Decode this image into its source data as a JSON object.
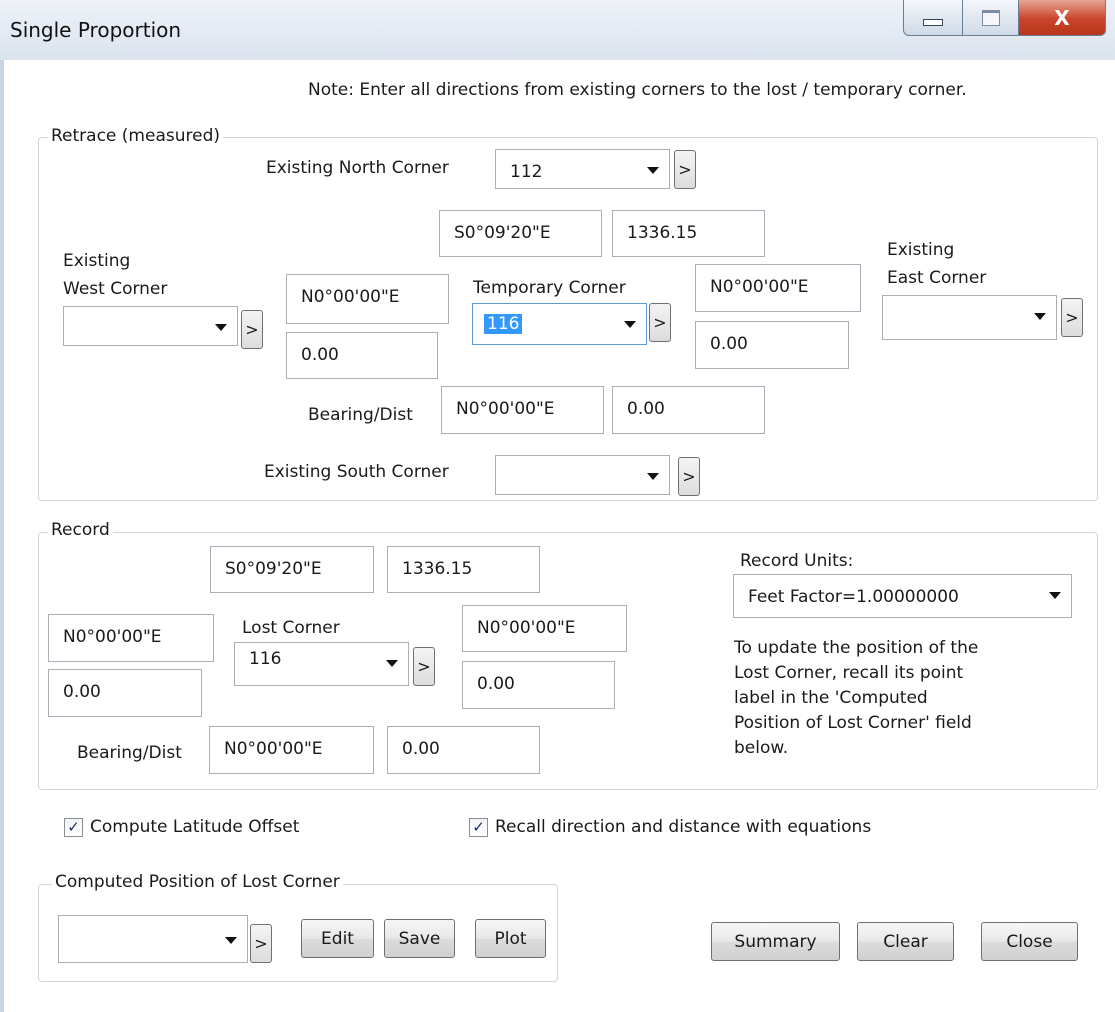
{
  "window": {
    "title": "Single Proportion",
    "close_glyph": "X"
  },
  "note": "Note: Enter all directions from existing corners to the lost / temporary corner.",
  "retrace": {
    "group_label": "Retrace (measured)",
    "north_label": "Existing North Corner",
    "north_value": "112",
    "north_bearing": "S0°09'20\"E",
    "north_distance": "1336.15",
    "west_label_1": "Existing",
    "west_label_2": "West Corner",
    "west_value": "",
    "west_bearing": "N0°00'00\"E",
    "west_distance": "0.00",
    "temp_label": "Temporary Corner",
    "temp_value": "116",
    "east_bearing": "N0°00'00\"E",
    "east_distance": "0.00",
    "east_label_1": "Existing",
    "east_label_2": "East Corner",
    "east_value": "",
    "bd_label": "Bearing/Dist",
    "bd_bearing": "N0°00'00\"E",
    "bd_distance": "0.00",
    "south_label": "Existing South Corner",
    "south_value": ""
  },
  "record": {
    "group_label": "Record",
    "north_bearing": "S0°09'20\"E",
    "north_distance": "1336.15",
    "west_bearing": "N0°00'00\"E",
    "west_distance": "0.00",
    "lost_label": "Lost Corner",
    "lost_value": "116",
    "east_bearing": "N0°00'00\"E",
    "east_distance": "0.00",
    "bd_label": "Bearing/Dist",
    "bd_bearing": "N0°00'00\"E",
    "bd_distance": "0.00",
    "units_label": "Record Units:",
    "units_value": "Feet  Factor=1.00000000",
    "help_lines": [
      "To update the position of the",
      "Lost Corner, recall its point",
      "label in the 'Computed",
      "Position of Lost Corner' field",
      "below."
    ]
  },
  "options": {
    "compute_latitude_label": "Compute Latitude Offset",
    "compute_latitude_checked": true,
    "recall_equations_label": "Recall direction  and distance with equations",
    "recall_equations_checked": true
  },
  "computed": {
    "group_label": "Computed Position of Lost Corner",
    "value": "",
    "edit_label": "Edit",
    "save_label": "Save",
    "plot_label": "Plot"
  },
  "footer": {
    "summary_label": "Summary",
    "clear_label": "Clear",
    "close_label": "Close"
  },
  "glyphs": {
    "recall_button": ">",
    "check": "✓"
  }
}
